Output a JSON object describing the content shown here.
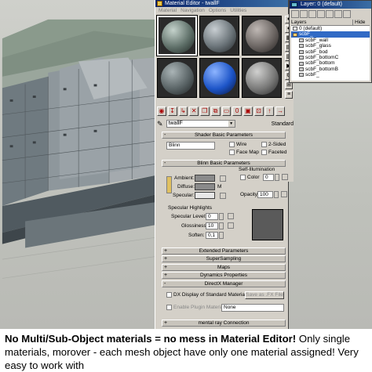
{
  "material_editor": {
    "title": "Material Editor - twallF",
    "menu": [
      "Material",
      "Navigation",
      "Options",
      "Utilities"
    ],
    "material_name": "twallF",
    "material_type": "Standard",
    "rollouts": {
      "shader_basic": "Shader Basic Parameters",
      "blinn_basic": "Blinn Basic Parameters",
      "extended": "Extended Parameters",
      "supersampling": "SuperSampling",
      "maps": "Maps",
      "dynamics": "Dynamics Properties",
      "directx": "DirectX Manager",
      "mental_ray": "mental ray Connection"
    },
    "shader": {
      "type": "Blinn",
      "wire": "Wire",
      "two_sided": "2-Sided",
      "face_map": "Face Map",
      "faceted": "Faceted"
    },
    "blinn": {
      "ambient": "Ambient:",
      "diffuse": "Diffuse:",
      "specular": "Specular:",
      "self_illum": "Self-Illumination",
      "color": "Color",
      "color_value": "0",
      "opacity_label": "Opacity:",
      "opacity": "100",
      "m_label": "M"
    },
    "highlights": {
      "title": "Specular Highlights",
      "spec_level_label": "Specular Level:",
      "spec_level": "0",
      "glossiness_label": "Glossiness:",
      "glossiness": "10",
      "soften_label": "Soften:",
      "soften": "0,1"
    },
    "directx": {
      "dx_display": "DX Display of Standard Material",
      "save_fx": "Save as .FX File",
      "enable_plugin": "Enable Plugin Material",
      "plugin_value": "None"
    }
  },
  "layer_window": {
    "title": "Layer: 0 (default)",
    "col_layers": "Layers",
    "col_hide": "Hide",
    "items": [
      "0 (default)",
      "scbF_",
      "scbF_wall",
      "scbF_glass",
      "scbF_bod",
      "scbF_bottomC",
      "scbF_bottom",
      "scbF_bottomB",
      "scbF_"
    ]
  },
  "caption": {
    "bold": "No Multi/Sub-Object materials = no mess in Material Editor!",
    "rest": " Only single materials, morover - each mesh object have only one material assigned! Very easy to work with"
  },
  "colors": {
    "title_bar": "#0a246a",
    "panel": "#d4d0c8",
    "selected": "#316ac5"
  }
}
